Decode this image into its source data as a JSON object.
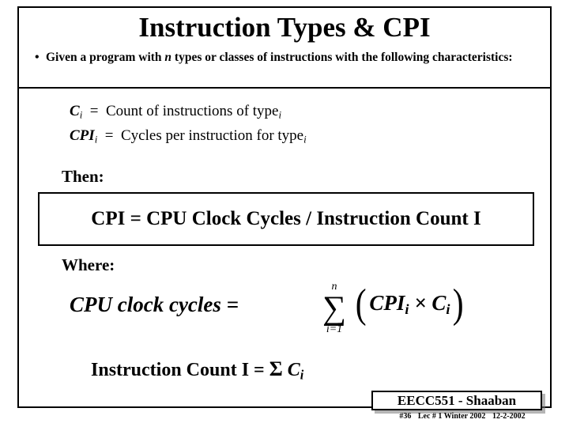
{
  "slide": {
    "title": "Instruction Types & CPI",
    "bullet": {
      "marker": "•",
      "text_part1": "Given a program with",
      "text_italic": "n",
      "text_part2": "types or classes of instructions with the following characteristics:"
    },
    "definitions": [
      {
        "symbol": "C",
        "symbol_sub": "i",
        "equals": "=",
        "text": "Count of instructions of type",
        "text_sub": "i"
      },
      {
        "symbol": "CPI",
        "symbol_sub": "i",
        "equals": "=",
        "text": "Cycles per instruction for type",
        "text_sub": "i"
      }
    ],
    "then_label": "Then:",
    "cpi_formula": "CPI  =  CPU Clock Cycles  /  Instruction Count  I",
    "where_label": "Where:",
    "equation": {
      "lhs": "CPU clock cycles  =",
      "sigma_top": "n",
      "sigma_glyph": "∑",
      "sigma_bottom": "i=1",
      "paren_open": "(",
      "inner": "CPI",
      "inner_sub1": "i",
      "times": "×",
      "inner2": "C",
      "inner_sub2": "i",
      "paren_close": ")"
    },
    "instruction_count_line": {
      "prefix": "Instruction Count  I  =",
      "sigma": "Σ",
      "symbol": "C",
      "symbol_sub": "i"
    },
    "footer": {
      "badge": "EECC551 - Shaaban",
      "slide_number": "#36",
      "lecture": "Lec # 1 Winter 2002",
      "date": "12-2-2002"
    }
  }
}
